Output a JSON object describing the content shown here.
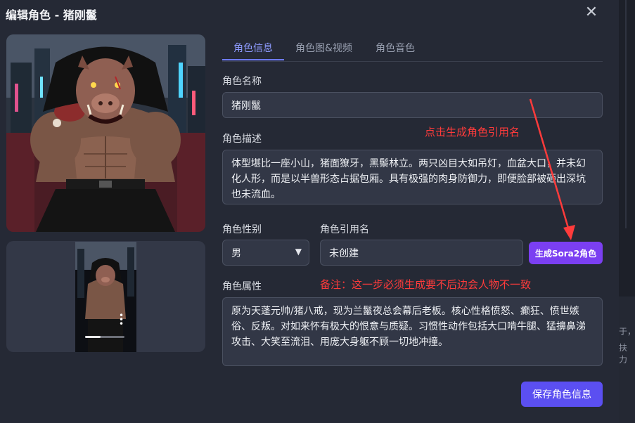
{
  "dialog": {
    "title": "编辑角色 - 猪刚鬣",
    "close_label": "✕"
  },
  "tabs": [
    {
      "label": "角色信息",
      "active": true
    },
    {
      "label": "角色图&视频",
      "active": false
    },
    {
      "label": "角色音色",
      "active": false
    }
  ],
  "form": {
    "name_label": "角色名称",
    "name_value": "猪刚鬣",
    "desc_label": "角色描述",
    "desc_value": "体型堪比一座小山，猪面獠牙，黑鬃林立。两只凶目大如吊灯，血盆大口，并未幻化人形，而是以半兽形态占据包厢。具有极强的肉身防御力，即便脸部被砸出深坑也未流血。",
    "gender_label": "角色性别",
    "gender_value": "男",
    "ref_label": "角色引用名",
    "ref_value": "未创建",
    "generate_button": "生成Sora2角色",
    "attr_label": "角色属性",
    "attr_value": "原为天蓬元帅/猪八戒，现为兰鬣夜总会幕后老板。核心性格愤怒、癫狂、愤世嫉俗、反叛。对如来怀有极大的恨意与质疑。习惯性动作包括大口啃牛腿、猛擤鼻涕攻击、大笑至流泪、用庞大身躯不顾一切地冲撞。",
    "save_button": "保存角色信息"
  },
  "annotations": {
    "click_hint": "点击生成角色引用名",
    "note": "备注：这一步必须生成要不后边会人物不一致",
    "color": "#ff3b3b"
  },
  "colors": {
    "accent_tab": "#8e9bff",
    "sora_button": "#7b3ff2",
    "save_button": "#5b4ff1"
  },
  "video_progress": 0.4,
  "side_fragments": {
    "line1": "于，",
    "line2": "扶力"
  }
}
